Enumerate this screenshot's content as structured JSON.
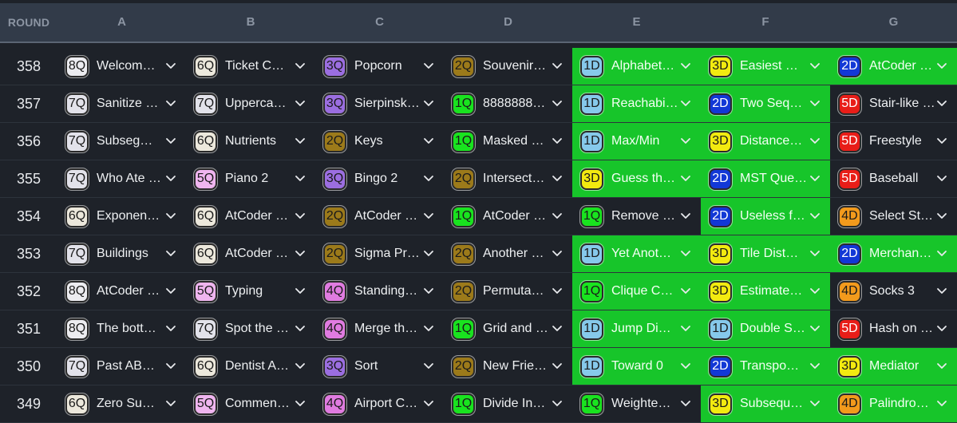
{
  "header": {
    "round_label": "ROUND",
    "columns": [
      "A",
      "B",
      "C",
      "D",
      "E",
      "F",
      "G"
    ]
  },
  "difficulty_colors": {
    "1": "#19e31f",
    "2": "#9c7a1a",
    "3": "#9b6ee0",
    "4": "#e07be0",
    "5": "#efb5ef",
    "6": "#ece8dc",
    "7": "#e2e2ea",
    "8": "#ececf0"
  },
  "tier_colors": {
    "1": "#86c9eb",
    "2": "#1238d6",
    "3": "#f2ea10",
    "4": "#f29a1c",
    "5": "#e81d18"
  },
  "solved_color": "#17c52a",
  "rows": [
    {
      "round": "358",
      "cells": [
        {
          "badge": "8Q",
          "name": "Welcom…",
          "solved": false
        },
        {
          "badge": "6Q",
          "name": "Ticket C…",
          "solved": false
        },
        {
          "badge": "3Q",
          "name": "Popcorn",
          "solved": false
        },
        {
          "badge": "2Q",
          "name": "Souvenir…",
          "solved": false
        },
        {
          "badge": "1D",
          "name": "Alphabet…",
          "solved": true
        },
        {
          "badge": "3D",
          "name": "Easiest …",
          "solved": true
        },
        {
          "badge": "2D",
          "name": "AtCoder …",
          "solved": true
        }
      ]
    },
    {
      "round": "357",
      "cells": [
        {
          "badge": "7Q",
          "name": "Sanitize …",
          "solved": false
        },
        {
          "badge": "7Q",
          "name": "Upperca…",
          "solved": false
        },
        {
          "badge": "3Q",
          "name": "Sierpinsk…",
          "solved": false
        },
        {
          "badge": "1Q",
          "name": "8888888…",
          "solved": false
        },
        {
          "badge": "1D",
          "name": "Reachabi…",
          "solved": true
        },
        {
          "badge": "2D",
          "name": "Two Seq…",
          "solved": true
        },
        {
          "badge": "5D",
          "name": "Stair-like …",
          "solved": false
        }
      ]
    },
    {
      "round": "356",
      "cells": [
        {
          "badge": "7Q",
          "name": "Subseg…",
          "solved": false
        },
        {
          "badge": "6Q",
          "name": "Nutrients",
          "solved": false
        },
        {
          "badge": "2Q",
          "name": "Keys",
          "solved": false
        },
        {
          "badge": "1Q",
          "name": "Masked …",
          "solved": false
        },
        {
          "badge": "1D",
          "name": "Max/Min",
          "solved": true
        },
        {
          "badge": "3D",
          "name": "Distance…",
          "solved": true
        },
        {
          "badge": "5D",
          "name": "Freestyle",
          "solved": false
        }
      ]
    },
    {
      "round": "355",
      "cells": [
        {
          "badge": "7Q",
          "name": "Who Ate …",
          "solved": false
        },
        {
          "badge": "5Q",
          "name": "Piano 2",
          "solved": false
        },
        {
          "badge": "3Q",
          "name": "Bingo 2",
          "solved": false
        },
        {
          "badge": "2Q",
          "name": "Intersect…",
          "solved": false
        },
        {
          "badge": "3D",
          "name": "Guess th…",
          "solved": true
        },
        {
          "badge": "2D",
          "name": "MST Que…",
          "solved": true
        },
        {
          "badge": "5D",
          "name": "Baseball",
          "solved": false
        }
      ]
    },
    {
      "round": "354",
      "cells": [
        {
          "badge": "6Q",
          "name": "Exponen…",
          "solved": false
        },
        {
          "badge": "6Q",
          "name": "AtCoder …",
          "solved": false
        },
        {
          "badge": "2Q",
          "name": "AtCoder …",
          "solved": false
        },
        {
          "badge": "1Q",
          "name": "AtCoder …",
          "solved": false
        },
        {
          "badge": "1Q",
          "name": "Remove …",
          "solved": false
        },
        {
          "badge": "2D",
          "name": "Useless f…",
          "solved": true
        },
        {
          "badge": "4D",
          "name": "Select St…",
          "solved": false
        }
      ]
    },
    {
      "round": "353",
      "cells": [
        {
          "badge": "7Q",
          "name": "Buildings",
          "solved": false
        },
        {
          "badge": "6Q",
          "name": "AtCoder …",
          "solved": false
        },
        {
          "badge": "2Q",
          "name": "Sigma Pr…",
          "solved": false
        },
        {
          "badge": "2Q",
          "name": "Another …",
          "solved": false
        },
        {
          "badge": "1D",
          "name": "Yet Anot…",
          "solved": true
        },
        {
          "badge": "3D",
          "name": "Tile Dist…",
          "solved": true
        },
        {
          "badge": "2D",
          "name": "Merchan…",
          "solved": true
        }
      ]
    },
    {
      "round": "352",
      "cells": [
        {
          "badge": "8Q",
          "name": "AtCoder …",
          "solved": false
        },
        {
          "badge": "5Q",
          "name": "Typing",
          "solved": false
        },
        {
          "badge": "4Q",
          "name": "Standing…",
          "solved": false
        },
        {
          "badge": "2Q",
          "name": "Permuta…",
          "solved": false
        },
        {
          "badge": "1Q",
          "name": "Clique C…",
          "solved": true
        },
        {
          "badge": "3D",
          "name": "Estimate…",
          "solved": true
        },
        {
          "badge": "4D",
          "name": "Socks 3",
          "solved": false
        }
      ]
    },
    {
      "round": "351",
      "cells": [
        {
          "badge": "8Q",
          "name": "The bott…",
          "solved": false
        },
        {
          "badge": "7Q",
          "name": "Spot the …",
          "solved": false
        },
        {
          "badge": "4Q",
          "name": "Merge th…",
          "solved": false
        },
        {
          "badge": "1Q",
          "name": "Grid and …",
          "solved": false
        },
        {
          "badge": "1D",
          "name": "Jump Di…",
          "solved": true
        },
        {
          "badge": "1D",
          "name": "Double S…",
          "solved": true
        },
        {
          "badge": "5D",
          "name": "Hash on …",
          "solved": false
        }
      ]
    },
    {
      "round": "350",
      "cells": [
        {
          "badge": "7Q",
          "name": "Past AB…",
          "solved": false
        },
        {
          "badge": "6Q",
          "name": "Dentist A…",
          "solved": false
        },
        {
          "badge": "3Q",
          "name": "Sort",
          "solved": false
        },
        {
          "badge": "2Q",
          "name": "New Frie…",
          "solved": false
        },
        {
          "badge": "1D",
          "name": "Toward 0",
          "solved": true
        },
        {
          "badge": "2D",
          "name": "Transpo…",
          "solved": true
        },
        {
          "badge": "3D",
          "name": "Mediator",
          "solved": true
        }
      ]
    },
    {
      "round": "349",
      "cells": [
        {
          "badge": "6Q",
          "name": "Zero Su…",
          "solved": false
        },
        {
          "badge": "5Q",
          "name": "Commen…",
          "solved": false
        },
        {
          "badge": "4Q",
          "name": "Airport C…",
          "solved": false
        },
        {
          "badge": "1Q",
          "name": "Divide In…",
          "solved": false
        },
        {
          "badge": "1Q",
          "name": "Weighte…",
          "solved": false
        },
        {
          "badge": "3D",
          "name": "Subsequ…",
          "solved": true
        },
        {
          "badge": "4D",
          "name": "Palindro…",
          "solved": true
        }
      ]
    }
  ]
}
